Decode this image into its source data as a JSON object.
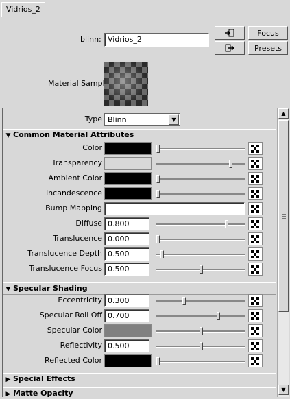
{
  "tab": {
    "label": "Vidrios_2"
  },
  "header": {
    "name_label": "blinn:",
    "name_value": "Vidrios_2",
    "focus_label": "Focus",
    "presets_label": "Presets",
    "sample_label": "Material Sample"
  },
  "type_row": {
    "label": "Type",
    "value": "Blinn"
  },
  "sections": {
    "common": "Common Material Attributes",
    "specular": "Specular Shading",
    "special": "Special Effects",
    "matte": "Matte Opacity"
  },
  "common_attrs": {
    "color": {
      "label": "Color",
      "swatch": "#000000",
      "level": 0.0
    },
    "transparency": {
      "label": "Transparency",
      "swatch": "#d8d8d8",
      "level": 0.85
    },
    "ambient": {
      "label": "Ambient Color",
      "swatch": "#000000",
      "level": 0.0
    },
    "incandescence": {
      "label": "Incandescence",
      "swatch": "#000000",
      "level": 0.0
    },
    "bump": {
      "label": "Bump Mapping"
    },
    "diffuse": {
      "label": "Diffuse",
      "value": "0.800",
      "level": 0.8
    },
    "translucence": {
      "label": "Translucence",
      "value": "0.000",
      "level": 0.0
    },
    "trans_depth": {
      "label": "Translucence Depth",
      "value": "0.500",
      "level": 0.05
    },
    "trans_focus": {
      "label": "Translucence Focus",
      "value": "0.500",
      "level": 0.5
    }
  },
  "specular_attrs": {
    "eccentricity": {
      "label": "Eccentricity",
      "value": "0.300",
      "level": 0.3
    },
    "rolloff": {
      "label": "Specular Roll Off",
      "value": "0.700",
      "level": 0.7
    },
    "spec_color": {
      "label": "Specular Color",
      "swatch": "#808080",
      "level": 0.5
    },
    "reflectivity": {
      "label": "Reflectivity",
      "value": "0.500",
      "level": 0.5
    },
    "reflected": {
      "label": "Reflected Color",
      "swatch": "#000000",
      "level": 0.0
    }
  },
  "colors": {
    "panel_bg": "#d8d8d8",
    "field_bg": "#ffffff"
  }
}
